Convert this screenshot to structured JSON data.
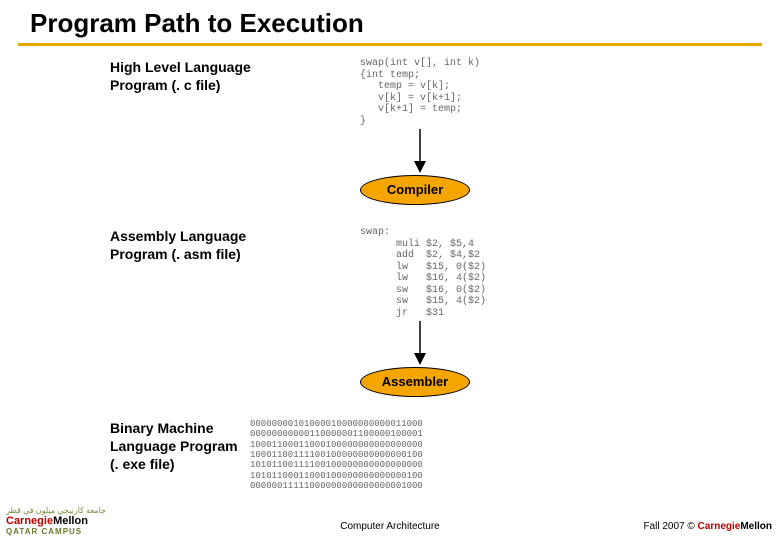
{
  "title": "Program Path to Execution",
  "stages": {
    "hll": {
      "label_l1": "High Level Language",
      "label_l2": "Program (. c file)",
      "code": "swap(int v[], int k)\n{int temp;\n   temp = v[k];\n   v[k] = v[k+1];\n   v[k+1] = temp;\n}"
    },
    "asm": {
      "label_l1": "Assembly Language",
      "label_l2": "Program (. asm file)",
      "code": "swap:\n      muli $2, $5,4\n      add  $2, $4,$2\n      lw   $15, 0($2)\n      lw   $16, 4($2)\n      sw   $16, 0($2)\n      sw   $15, 4($2)\n      jr   $31"
    },
    "bin": {
      "label_l1": "Binary Machine",
      "label_l2": "Language Program",
      "label_l3": "(. exe file)",
      "code": "00000000101000010000000000011000\n00000000000110000001100000100001\n10001100011000100000000000000000\n10001100111100100000000000000100\n10101100111100100000000000000000\n10101100011000100000000000000100\n00000011111000000000000000001000"
    }
  },
  "processors": {
    "compiler": "Compiler",
    "assembler": "Assembler"
  },
  "footer": {
    "arabic": "جامعة كارنيجي ميلون في قطر",
    "cm1": "Carnegie",
    "cm2": "Mellon",
    "qatar": "QATAR CAMPUS",
    "center": "Computer Architecture",
    "right_prefix": "Fall 2007 ©"
  }
}
